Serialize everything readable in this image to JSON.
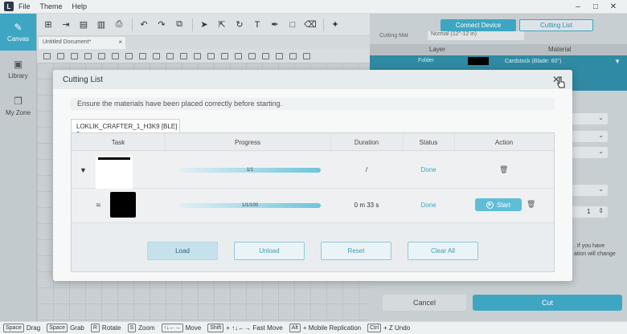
{
  "menubar": {
    "items": [
      "File",
      "Theme",
      "Help"
    ],
    "app_icon": "app-logo"
  },
  "window_controls": {
    "minimize": "–",
    "maximize": "□",
    "close": "✕"
  },
  "sidebar": {
    "items": [
      {
        "label": "Canvas",
        "icon": "canvas-icon",
        "active": true
      },
      {
        "label": "Library",
        "icon": "library-icon",
        "active": false
      },
      {
        "label": "My Zone",
        "icon": "myzone-icon",
        "active": false
      }
    ]
  },
  "document": {
    "tab_title": "Untitled Document*",
    "close": "×"
  },
  "right_panel": {
    "connect_device": "Connect Device",
    "cutting_list": "Cutting List",
    "cutting_mat_label": "Cutting Mat",
    "cutting_mat_value": "Normal (12\"-12 in)",
    "layer_header": "Layer",
    "material_header": "Material",
    "layer_name": "Folder",
    "material_value": "Cardstock (Blade: 60°)",
    "note_line1": ". If you have",
    "note_line2": "ation will change",
    "stepper_value": "1",
    "cancel": "Cancel",
    "cut": "Cut"
  },
  "statusbar": [
    {
      "key": "Space",
      "label": "Drag"
    },
    {
      "key": "Space",
      "label": "Grab"
    },
    {
      "key": "R",
      "label": "Rotate"
    },
    {
      "key": "S",
      "label": "Zoom"
    },
    {
      "key": "↑↓←→",
      "label": "Move"
    },
    {
      "key": "Shift",
      "label": "+ ↑↓←→ Fast Move"
    },
    {
      "key": "Alt",
      "label": "+ Mobile Replication"
    },
    {
      "key": "Ctrl",
      "label": "+ Z Undo"
    }
  ],
  "modal": {
    "title": "Cutting List",
    "close": "✕",
    "notice": "Ensure the materials have been placed correctly before starting.",
    "device_tab": "LOKLIK_CRAFTER_1_H3K9 [BLE]",
    "columns": [
      "Task",
      "Progress",
      "Duration",
      "Status",
      "Action"
    ],
    "rows": [
      {
        "progress": 1.0,
        "progress_label": "1/1",
        "duration": "/",
        "status": "Done",
        "start": ""
      },
      {
        "progress": 1.0,
        "progress_label": "1/1/100",
        "duration": "0 m 33 s",
        "status": "Done",
        "start": "Start"
      }
    ],
    "buttons": {
      "load": "Load",
      "unload": "Unload",
      "reset": "Reset",
      "clear_all": "Clear All"
    }
  },
  "colors": {
    "accent": "#3ea6c2",
    "layer_row": "#2f8aa3"
  }
}
